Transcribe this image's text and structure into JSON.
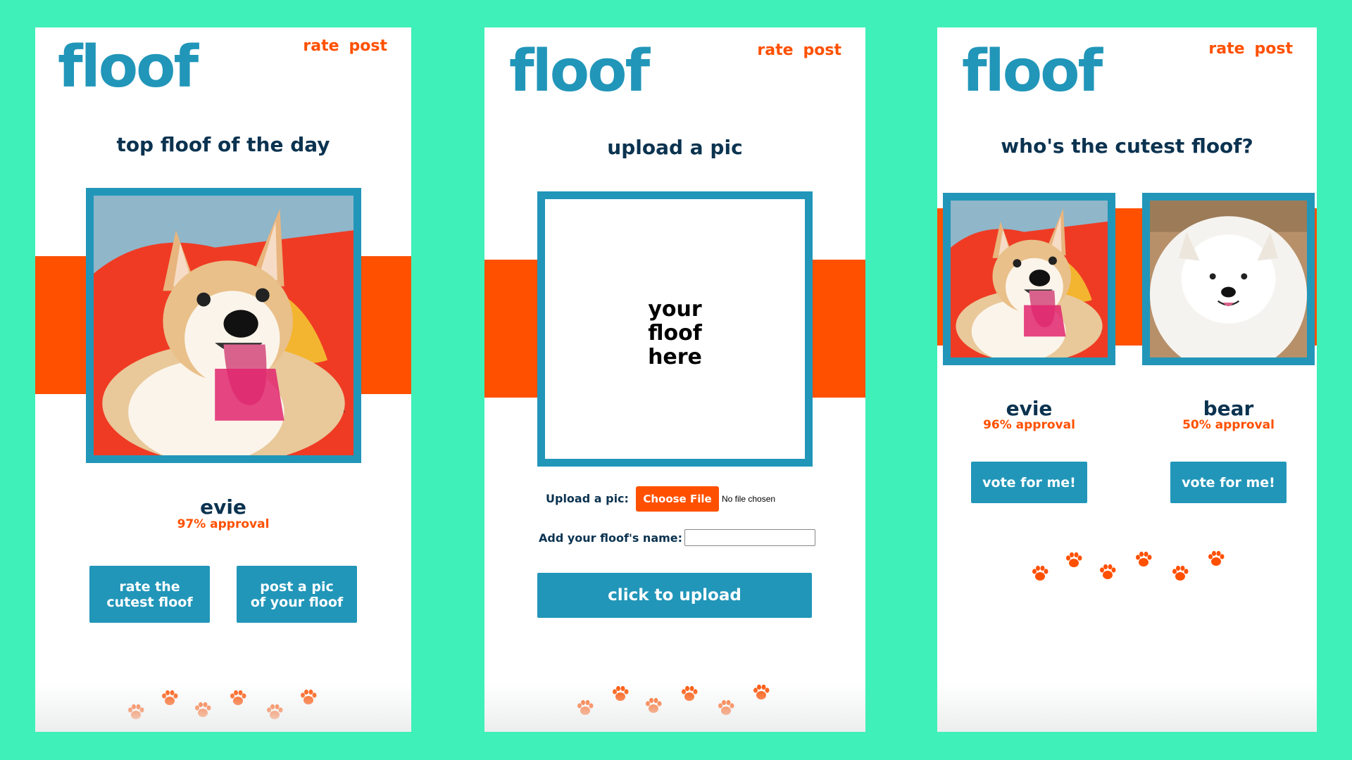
{
  "brand": {
    "logo": "floof",
    "color_primary": "#2196b9",
    "color_accent": "#ff5000",
    "color_dark": "#0b3350",
    "background": "#3ff0b8"
  },
  "nav": {
    "rate_label": "rate",
    "post_label": "post"
  },
  "home": {
    "heading": "top floof of the day",
    "dog": {
      "name": "evie",
      "approval": "97% approval",
      "photo": "corgi-photo"
    },
    "rate_button": [
      "rate the",
      "cutest floof"
    ],
    "post_button": [
      "post a pic",
      "of your floof"
    ]
  },
  "upload": {
    "heading": "upload a pic",
    "placeholder_lines": [
      "your",
      "floof",
      "here"
    ],
    "upload_label": "Upload a pic:",
    "choose_file": "Choose File",
    "no_file": "No file chosen",
    "name_label": "Add your floof's name:",
    "name_value": "",
    "submit": "click to upload"
  },
  "rate": {
    "heading": "who's the cutest floof?",
    "dogs": [
      {
        "name": "evie",
        "approval": "96% approval",
        "vote": "vote for me!",
        "photo": "corgi-photo"
      },
      {
        "name": "bear",
        "approval": "50% approval",
        "vote": "vote for me!",
        "photo": "samoyed-photo"
      }
    ]
  },
  "icons": {
    "footer": "paw-print-icon"
  }
}
